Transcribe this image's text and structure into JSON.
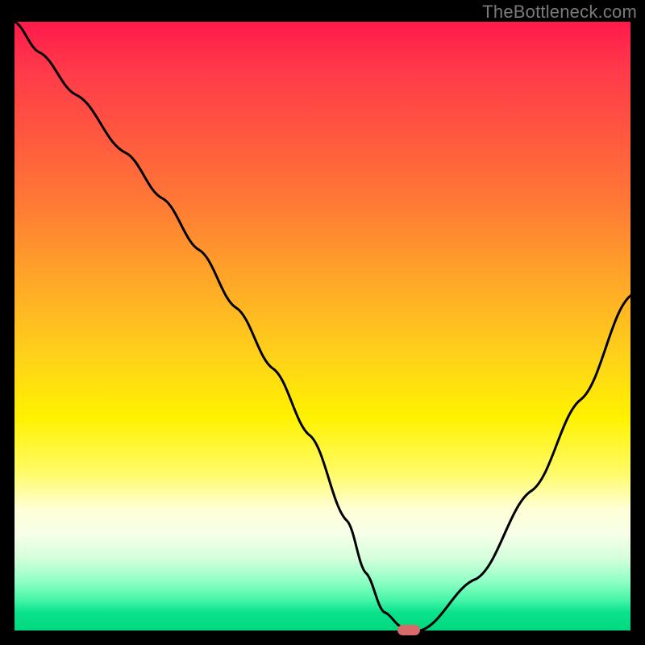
{
  "watermark": "TheBottleneck.com",
  "chart_data": {
    "type": "line",
    "title": "",
    "xlabel": "",
    "ylabel": "",
    "xlim": [
      0,
      100
    ],
    "ylim": [
      0,
      100
    ],
    "x": [
      0,
      4,
      10,
      18,
      24,
      30,
      36,
      42,
      48,
      54,
      57,
      60,
      63,
      66,
      75,
      84,
      92,
      100
    ],
    "values": [
      100,
      95,
      88,
      78.5,
      71,
      62.5,
      53,
      43,
      32,
      18,
      9.5,
      3,
      0.5,
      0,
      8.5,
      23,
      38,
      55
    ],
    "marker_x": 64,
    "marker_y": 0,
    "series": [
      {
        "name": "bottleneck-curve",
        "values": [
          100,
          95,
          88,
          78.5,
          71,
          62.5,
          53,
          43,
          32,
          18,
          9.5,
          3,
          0.5,
          0,
          8.5,
          23,
          38,
          55
        ]
      }
    ],
    "annotations": [
      {
        "type": "watermark",
        "text": "TheBottleneck.com"
      }
    ]
  },
  "colors": {
    "curve": "#000000",
    "marker": "#d96a6a",
    "background": "#000000"
  }
}
